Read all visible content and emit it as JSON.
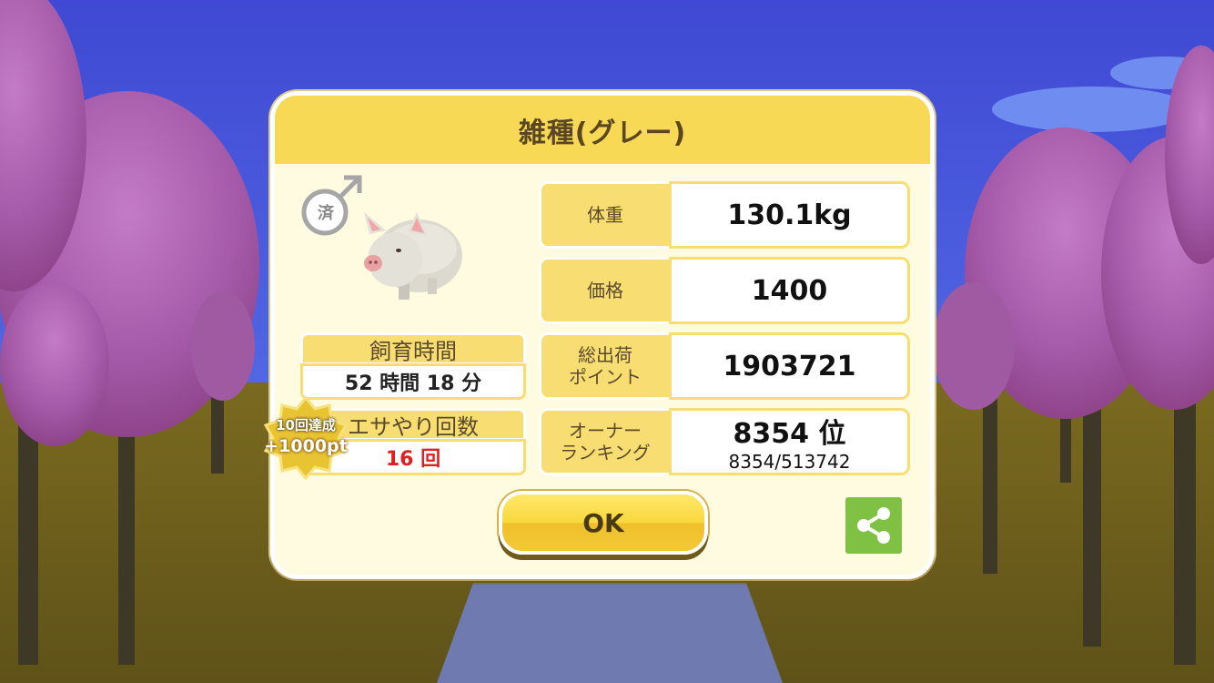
{
  "title": "雑種(グレー)",
  "gender_icon": "male-symbol",
  "neutered_badge": "済",
  "stats": [
    {
      "label": "体重",
      "value": "130.1kg"
    },
    {
      "label": "価格",
      "value": "1400"
    },
    {
      "label": "総出荷\nポイント",
      "value": "1903721"
    },
    {
      "label": "オーナー\nランキング",
      "value": "8354 位",
      "sub": "8354/513742"
    }
  ],
  "raising_time": {
    "label": "飼育時間",
    "value": "52 時間 18 分"
  },
  "feeding": {
    "label": "エサやり回数",
    "value": "16 回"
  },
  "achievement": {
    "line1": "10回達成",
    "line2": "+1000pt"
  },
  "ok_label": "OK",
  "share_icon": "share-icon",
  "colors": {
    "accent": "#f8d955",
    "share": "#7fc142",
    "count": "#e02020",
    "sky": "#4a55d8"
  }
}
